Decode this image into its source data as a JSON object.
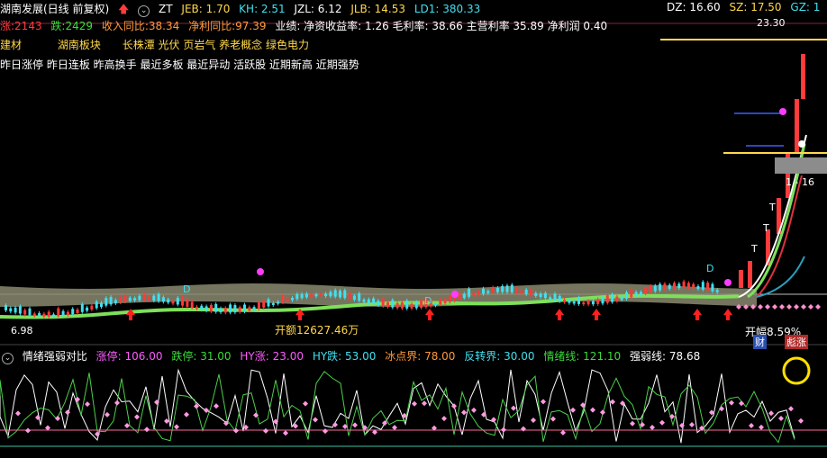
{
  "header": {
    "title": "湖南发展(日线 前复权)",
    "zt": "ZT",
    "jeb": "JEB: 1.70",
    "kh": "KH: 2.51",
    "jzl": "JZL: 6.12",
    "jlb": "JLB: 14.53",
    "ld1": "LD1: 380.33",
    "dz": "DZ: 16.60",
    "sz": "SZ: 17.50",
    "gz": "GZ: 1"
  },
  "row2": {
    "zhang": "涨:2143",
    "die": "跌:2429",
    "income": "收入同比:38.34",
    "profit": "净利同比:97.39",
    "business": "业绩: 净资收益率: 1.26 毛利率: 38.66 主营利率 35.89 净利润 0.40"
  },
  "row3": {
    "a": "建材",
    "b": "湖南板块",
    "c": "长株潭 光伏 页岩气 养老概念 绿色电力"
  },
  "row4": {
    "text": "昨日涨停 昨日连板 昨高换手 最近多板 最近异动 活跃股 近期新高 近期强势"
  },
  "chart_labels": {
    "price_top": "23.30",
    "range_right": "1 - 16",
    "low_price": "6.98",
    "amount": "开额12627.46万",
    "open_gain": "开幅8.59%",
    "cai": "财",
    "biao": "彪涨",
    "d1": "D",
    "d2": "D",
    "d3": "D",
    "t1": "T",
    "t2": "T",
    "t3": "T"
  },
  "indicator": {
    "name": "情绪强弱对比",
    "zt": "涨停: 106.00",
    "dt": "跌停: 31.00",
    "hyz": "HY涨: 23.00",
    "hyd": "HY跌: 53.00",
    "bdj": "冰点界: 78.00",
    "fzj": "反转界: 30.00",
    "qxx": "情绪线: 121.10",
    "qrx": "强弱线: 78.68"
  },
  "colors": {
    "up": "#ff3b3b",
    "down": "#40e0f0",
    "ma_green": "#7ee05a",
    "band": "#8a8a70",
    "accent": "#ffd84a"
  }
}
